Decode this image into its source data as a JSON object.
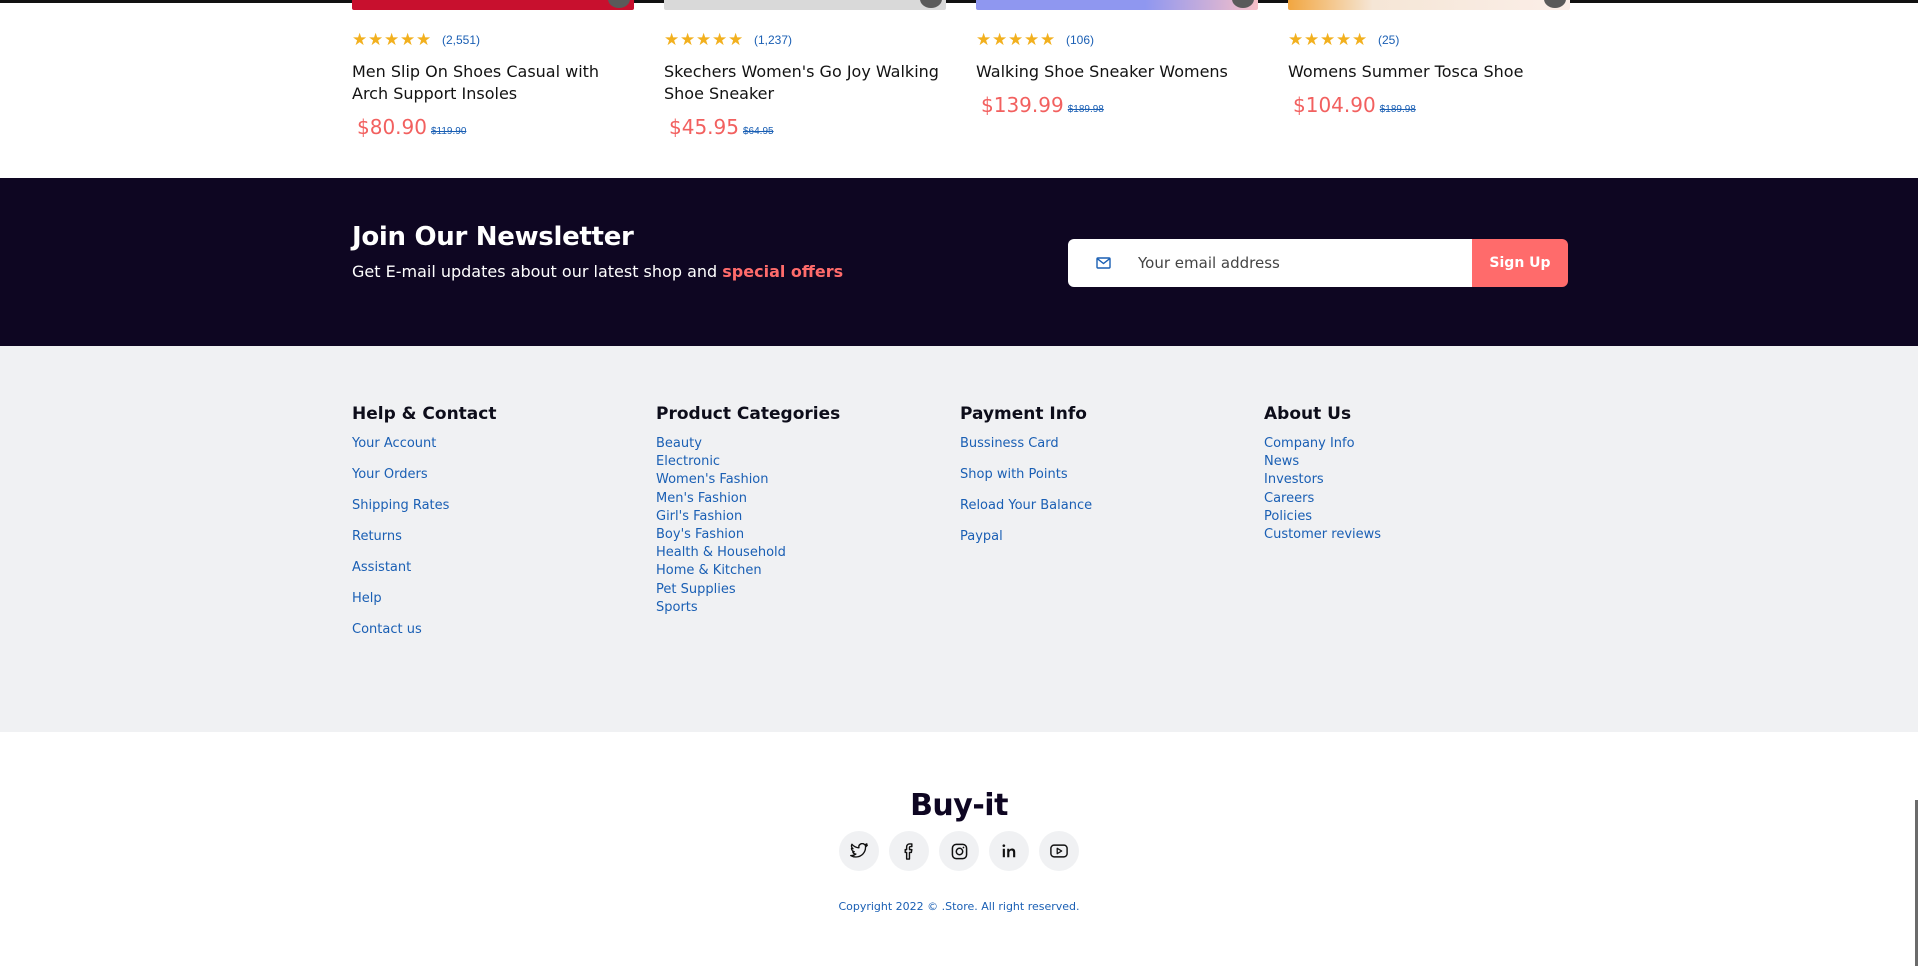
{
  "products": [
    {
      "rating_count": "(2,551)",
      "name": "Men Slip On Shoes Casual with Arch Support Insoles",
      "price": "$80.90",
      "old_price": "$119.90",
      "image_color": "#c8102e"
    },
    {
      "rating_count": "(1,237)",
      "name": "Skechers Women's Go Joy Walking Shoe Sneaker",
      "price": "$45.95",
      "old_price": "$64.95",
      "image_color": "#d9d9d9"
    },
    {
      "rating_count": "(106)",
      "name": "Walking Shoe Sneaker Womens",
      "price": "$139.99",
      "old_price": "$189.98",
      "image_color": "#8f97f0"
    },
    {
      "rating_count": "(25)",
      "name": "Womens Summer Tosca Shoe",
      "price": "$104.90",
      "old_price": "$189.98",
      "image_color": "#f5e6d6"
    }
  ],
  "rating_stars": 5,
  "newsletter": {
    "title": "Join Our Newsletter",
    "subtitle": "Get E-mail updates about our latest shop and",
    "highlight": "special offers",
    "placeholder": "Your email address",
    "button": "Sign Up"
  },
  "footer": {
    "help": {
      "title": "Help & Contact",
      "items": [
        "Your Account",
        "Your Orders",
        "Shipping Rates",
        "Returns",
        "Assistant",
        "Help",
        "Contact us"
      ]
    },
    "categories": {
      "title": "Product Categories",
      "items": [
        "Beauty",
        "Electronic",
        "Women's Fashion",
        "Men's Fashion",
        "Girl's Fashion",
        "Boy's Fashion",
        "Health & Household",
        "Home & Kitchen",
        "Pet Supplies",
        "Sports"
      ]
    },
    "payment": {
      "title": "Payment Info",
      "items": [
        "Bussiness Card",
        "Shop with Points",
        "Reload Your Balance",
        "Paypal"
      ]
    },
    "about": {
      "title": "About Us",
      "items": [
        "Company Info",
        "News",
        "Investors",
        "Careers",
        "Policies",
        "Customer reviews"
      ]
    }
  },
  "brand": "Buy-it",
  "social": [
    "twitter-icon",
    "facebook-icon",
    "instagram-icon",
    "linkedin-icon",
    "youtube-icon"
  ],
  "copyright": "Copyright 2022 © .Store. All right reserved.",
  "colors": {
    "accent": "#ff6b6b",
    "navy": "#0e0622",
    "link": "#1a5fb4",
    "star": "#f2b01e"
  }
}
